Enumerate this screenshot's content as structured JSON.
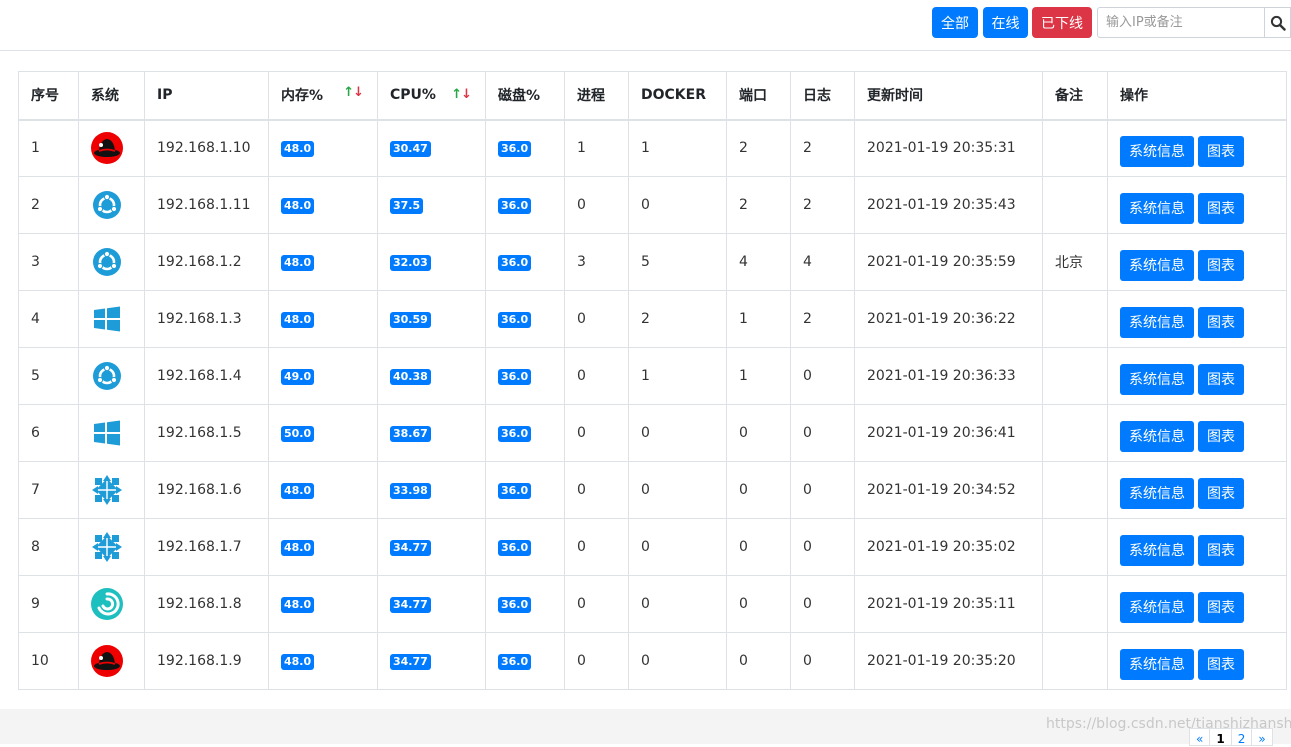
{
  "toolbar": {
    "all_label": "全部",
    "online_label": "在线",
    "offline_label": "已下线",
    "search_placeholder": "输入IP或备注"
  },
  "table": {
    "headers": {
      "seq": "序号",
      "os": "系统",
      "ip": "IP",
      "mem": "内存%",
      "cpu": "CPU%",
      "disk": "磁盘%",
      "proc": "进程",
      "docker": "DOCKER",
      "port": "端口",
      "log": "日志",
      "updated": "更新时间",
      "remark": "备注",
      "action": "操作"
    },
    "rows": [
      {
        "seq": "1",
        "os": "redhat-icon",
        "ip": "192.168.1.10",
        "mem": "48.0",
        "cpu": "30.47",
        "disk": "36.0",
        "proc": "1",
        "docker": "1",
        "port": "2",
        "log": "2",
        "updated": "2021-01-19 20:35:31",
        "remark": ""
      },
      {
        "seq": "2",
        "os": "ubuntu-icon",
        "ip": "192.168.1.11",
        "mem": "48.0",
        "cpu": "37.5",
        "disk": "36.0",
        "proc": "0",
        "docker": "0",
        "port": "2",
        "log": "2",
        "updated": "2021-01-19 20:35:43",
        "remark": ""
      },
      {
        "seq": "3",
        "os": "ubuntu-icon",
        "ip": "192.168.1.2",
        "mem": "48.0",
        "cpu": "32.03",
        "disk": "36.0",
        "proc": "3",
        "docker": "5",
        "port": "4",
        "log": "4",
        "updated": "2021-01-19 20:35:59",
        "remark": "北京"
      },
      {
        "seq": "4",
        "os": "windows-icon",
        "ip": "192.168.1.3",
        "mem": "48.0",
        "cpu": "30.59",
        "disk": "36.0",
        "proc": "0",
        "docker": "2",
        "port": "1",
        "log": "2",
        "updated": "2021-01-19 20:36:22",
        "remark": ""
      },
      {
        "seq": "5",
        "os": "ubuntu-icon",
        "ip": "192.168.1.4",
        "mem": "49.0",
        "cpu": "40.38",
        "disk": "36.0",
        "proc": "0",
        "docker": "1",
        "port": "1",
        "log": "0",
        "updated": "2021-01-19 20:36:33",
        "remark": ""
      },
      {
        "seq": "6",
        "os": "windows-icon",
        "ip": "192.168.1.5",
        "mem": "50.0",
        "cpu": "38.67",
        "disk": "36.0",
        "proc": "0",
        "docker": "0",
        "port": "0",
        "log": "0",
        "updated": "2021-01-19 20:36:41",
        "remark": ""
      },
      {
        "seq": "7",
        "os": "centos-icon",
        "ip": "192.168.1.6",
        "mem": "48.0",
        "cpu": "33.98",
        "disk": "36.0",
        "proc": "0",
        "docker": "0",
        "port": "0",
        "log": "0",
        "updated": "2021-01-19 20:34:52",
        "remark": ""
      },
      {
        "seq": "8",
        "os": "centos-icon",
        "ip": "192.168.1.7",
        "mem": "48.0",
        "cpu": "34.77",
        "disk": "36.0",
        "proc": "0",
        "docker": "0",
        "port": "0",
        "log": "0",
        "updated": "2021-01-19 20:35:02",
        "remark": ""
      },
      {
        "seq": "9",
        "os": "debian-icon",
        "ip": "192.168.1.8",
        "mem": "48.0",
        "cpu": "34.77",
        "disk": "36.0",
        "proc": "0",
        "docker": "0",
        "port": "0",
        "log": "0",
        "updated": "2021-01-19 20:35:11",
        "remark": ""
      },
      {
        "seq": "10",
        "os": "redhat-icon",
        "ip": "192.168.1.9",
        "mem": "48.0",
        "cpu": "34.77",
        "disk": "36.0",
        "proc": "0",
        "docker": "0",
        "port": "0",
        "log": "0",
        "updated": "2021-01-19 20:35:20",
        "remark": ""
      }
    ],
    "action_info_label": "系统信息",
    "action_chart_label": "图表"
  },
  "sort_icons": {
    "up": "↑",
    "down": "↓"
  },
  "pagination": {
    "prev": "«",
    "pages": [
      "1",
      "2"
    ],
    "current": "1",
    "next": "»"
  },
  "watermark": "https://blog.csdn.net/tianshizhanshi",
  "colors": {
    "primary": "#007bff",
    "danger": "#dc3545",
    "sort_up": "#28a745",
    "sort_down": "#dc3545"
  }
}
